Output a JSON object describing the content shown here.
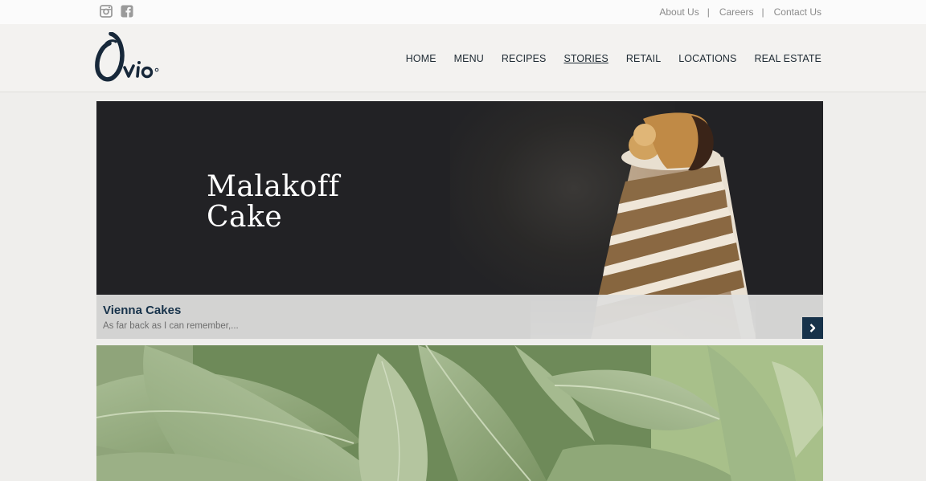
{
  "topbar": {
    "social": [
      {
        "icon": "instagram-icon"
      },
      {
        "icon": "facebook-icon"
      }
    ],
    "links": [
      {
        "label": "About Us"
      },
      {
        "label": "Careers"
      },
      {
        "label": "Contact Us"
      }
    ],
    "separator": "|"
  },
  "header": {
    "logo_text": "Ovio",
    "nav": [
      {
        "label": "HOME"
      },
      {
        "label": "MENU"
      },
      {
        "label": "RECIPES"
      },
      {
        "label": "STORIES",
        "active": true
      },
      {
        "label": "RETAIL"
      },
      {
        "label": "LOCATIONS"
      },
      {
        "label": "REAL ESTATE"
      }
    ]
  },
  "hero": {
    "image_title": "Malakoff\nCake",
    "caption_title": "Vienna Cakes",
    "caption_sub": "As far back as I can remember,...",
    "arrow_icon": "chevron-right-icon"
  },
  "colors": {
    "brand_navy": "#17324a",
    "hero_dark": "#222225",
    "page_bg": "#efeeec"
  }
}
